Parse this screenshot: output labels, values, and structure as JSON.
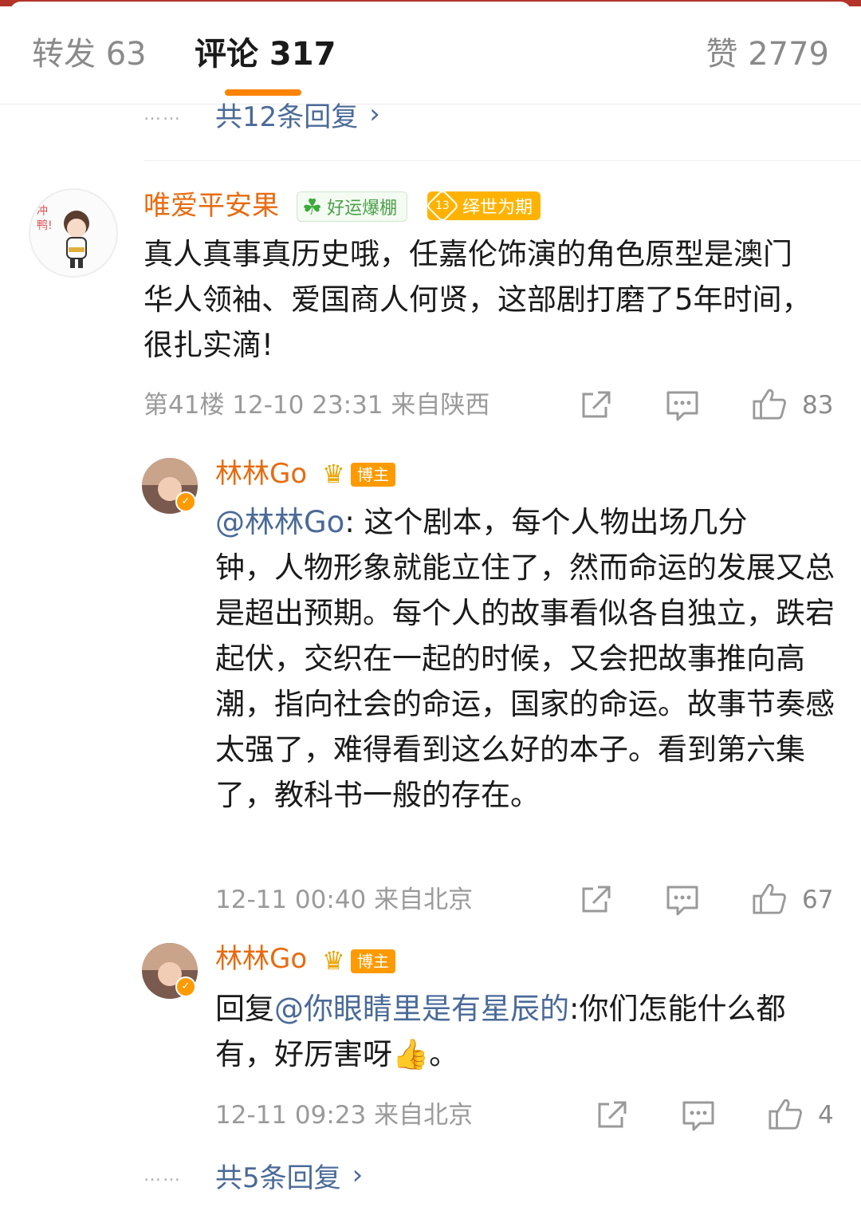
{
  "tabs": {
    "repost": "转发 63",
    "comments": "评论 317",
    "likes": "赞 2779"
  },
  "top_more": {
    "dots": "……",
    "label": "共12条回复"
  },
  "comment": {
    "username": "唯爱平安果",
    "avatar_text": "冲鸭!",
    "badge_luck": "好运爆棚",
    "badge_year_num": "13",
    "badge_year": "绎世为期",
    "text": "真人真事真历史哦，任嘉伦饰演的角色原型是澳门华人领袖、爱国商人何贤，这部剧打磨了5年时间，很扎实滴!",
    "meta": "第41楼  12-10 23:31  来自陕西",
    "likes": "83"
  },
  "replies": [
    {
      "username": "林林Go",
      "host_badge": "博主",
      "mention": "@林林Go",
      "text_line1": ": 这个剧本，每个人物出场几分",
      "text_rest": "钟，人物形象就能立住了，然而命运的发展又总是超出预期。每个人的故事看似各自独立，跌宕起伏，交织在一起的时候，又会把故事推向高潮，指向社会的命运，国家的命运。故事节奏感太强了，难得看到这么好的本子。看到第六集了，教科书一般的存在。",
      "meta": "12-11 00:40  来自北京",
      "likes": "67"
    },
    {
      "username": "林林Go",
      "host_badge": "博主",
      "prefix": "回复",
      "mention": "@你眼睛里是有星辰的",
      "text": ":你们怎能什么都有，好厉害呀",
      "emoji": "👍",
      "tail": "。",
      "meta": "12-11 09:23  来自北京",
      "likes": "4"
    }
  ],
  "bottom_more": {
    "dots": "……",
    "label": "共5条回复"
  },
  "colors": {
    "username": "#e86b10",
    "link": "#4a6a98",
    "accent": "#ff8200"
  },
  "icons": [
    "share-icon",
    "comment-icon",
    "like-icon",
    "chevron-right-icon",
    "crown-icon",
    "clover-icon",
    "verified-icon"
  ]
}
